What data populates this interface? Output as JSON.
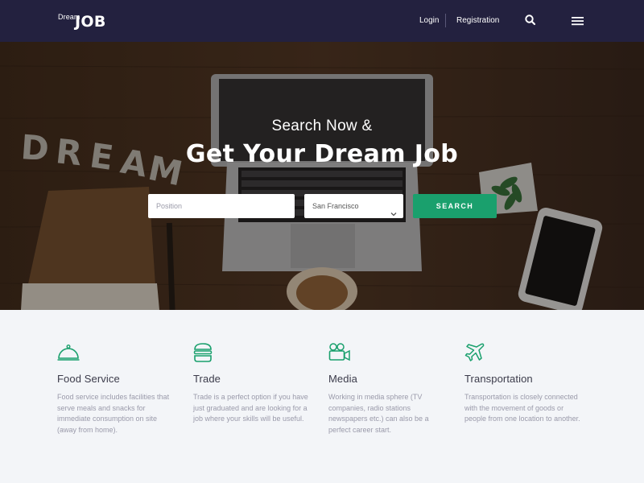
{
  "header": {
    "logo_small": "Dream",
    "logo_big": "JOB",
    "nav": {
      "login": "Login",
      "registration": "Registration"
    },
    "icons": {
      "search": "search-icon",
      "menu": "hamburger-menu-icon"
    },
    "background": "#23213f"
  },
  "hero": {
    "subtitle": "Search Now &",
    "title": "Get Your Dream Job",
    "position_placeholder": "Position",
    "location_value": "San Francisco",
    "search_label": "SEARCH",
    "accent": "#1aa06d"
  },
  "categories": [
    {
      "icon": "cloche-icon",
      "title": "Food Service",
      "description": "Food service includes facilities that serve meals and snacks for immediate consumption on site (away from home)."
    },
    {
      "icon": "burger-icon",
      "title": "Trade",
      "description": "Trade is a perfect option if you have just graduated and are looking for a job where your skills will be useful."
    },
    {
      "icon": "video-camera-icon",
      "title": "Media",
      "description": "Working in media sphere (TV companies, radio stations newspapers etc.) can also be a perfect career start."
    },
    {
      "icon": "airplane-icon",
      "title": "Transportation",
      "description": "Transportation is closely connected with the movement of goods or people from one location to another."
    }
  ],
  "colors": {
    "accent": "#1aa06d",
    "header": "#23213f",
    "section_bg": "#f3f5f8"
  }
}
